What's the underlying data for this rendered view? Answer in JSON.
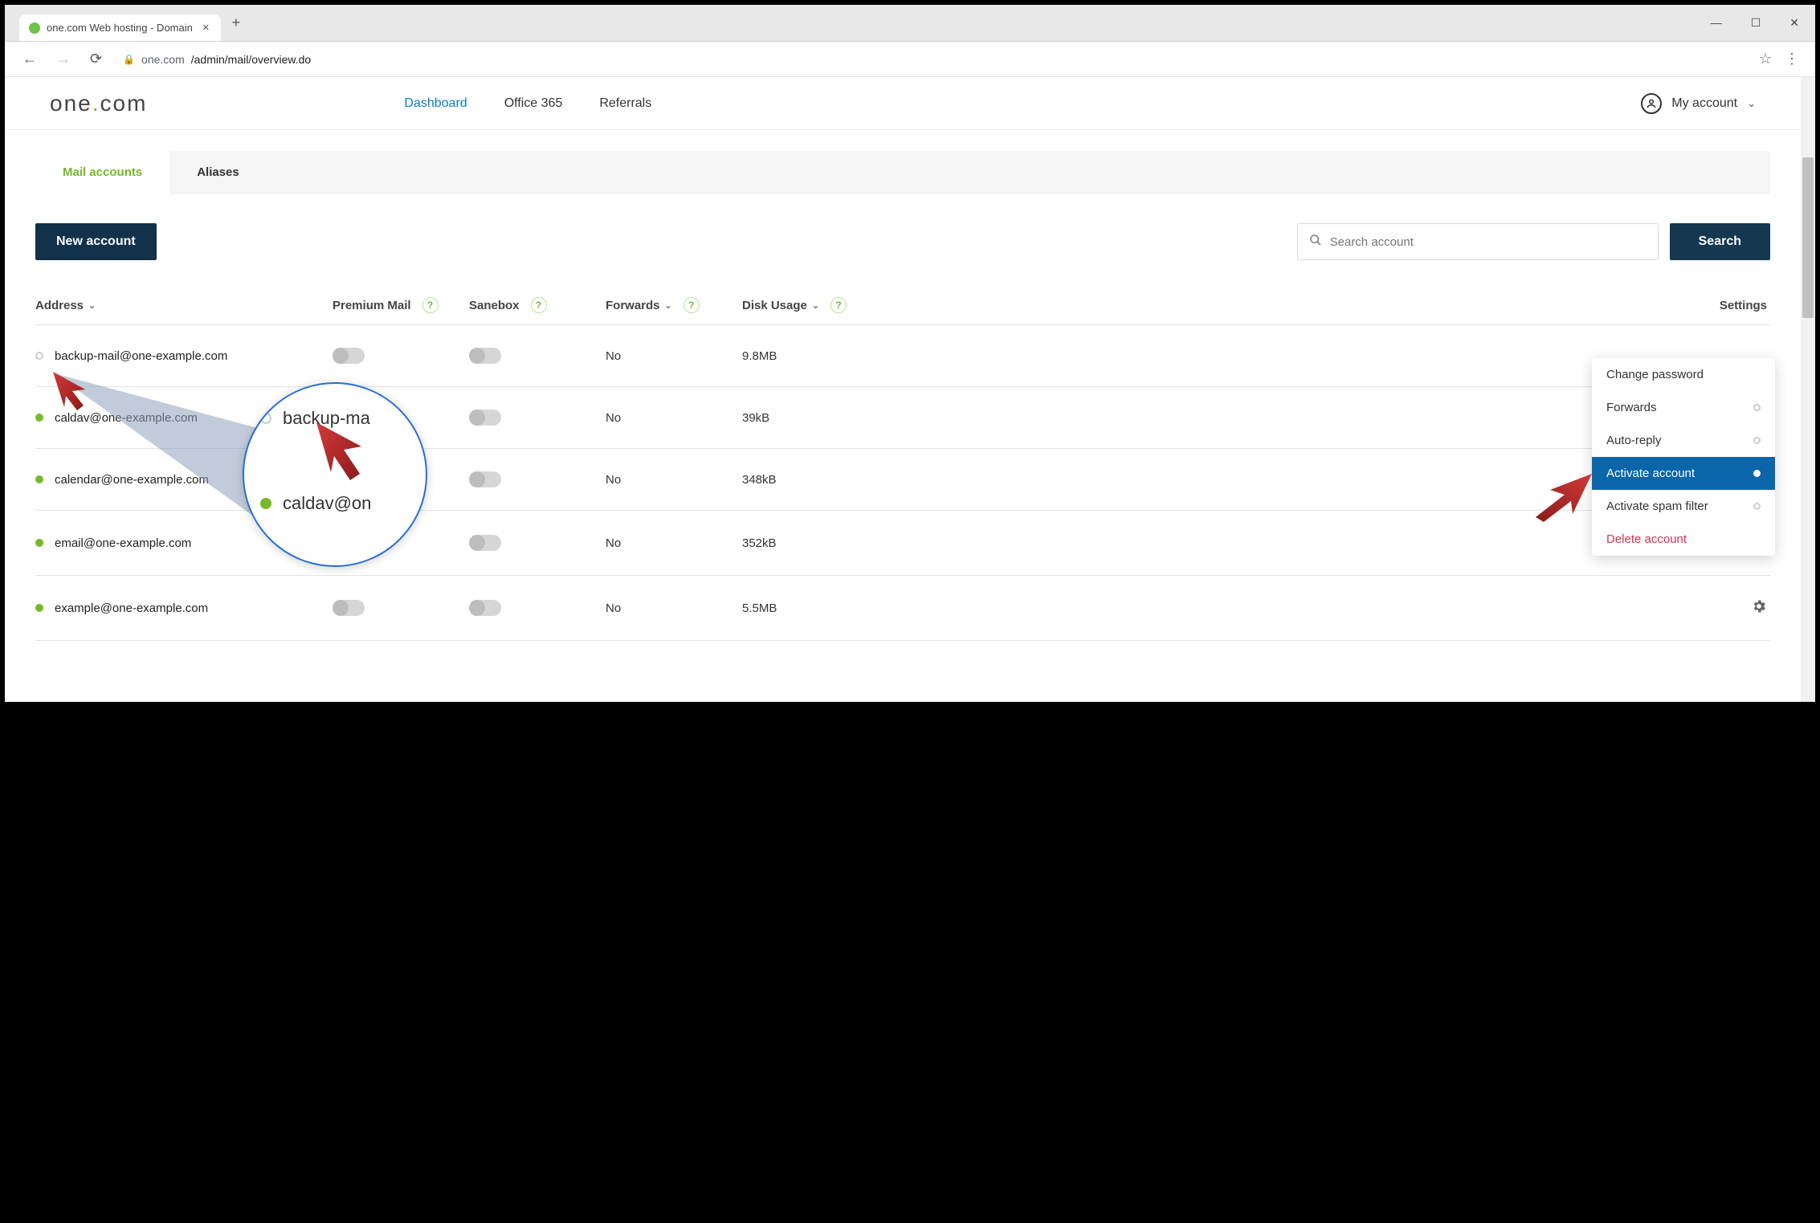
{
  "browser": {
    "tab_title": "one.com Web hosting  -  Domain",
    "url_host": "one.com",
    "url_path": "/admin/mail/overview.do"
  },
  "header": {
    "nav": {
      "dashboard": "Dashboard",
      "office365": "Office 365",
      "referrals": "Referrals"
    },
    "account_label": "My account"
  },
  "subtabs": {
    "mail_accounts": "Mail accounts",
    "aliases": "Aliases"
  },
  "actions": {
    "new_account": "New account",
    "search_placeholder": "Search account",
    "search_button": "Search"
  },
  "columns": {
    "address": "Address",
    "premium": "Premium Mail",
    "sanebox": "Sanebox",
    "forwards": "Forwards",
    "disk": "Disk Usage",
    "settings": "Settings"
  },
  "rows": [
    {
      "active": false,
      "address": "backup-mail@one-example.com",
      "premium": false,
      "sanebox": false,
      "forwards": "No",
      "disk": "9.8MB",
      "has_gear": false
    },
    {
      "active": true,
      "address": "caldav@one-example.com",
      "premium": false,
      "sanebox": false,
      "forwards": "No",
      "disk": "39kB",
      "has_gear": false
    },
    {
      "active": true,
      "address": "calendar@one-example.com",
      "premium": false,
      "sanebox": false,
      "forwards": "No",
      "disk": "348kB",
      "has_gear": false
    },
    {
      "active": true,
      "address": "email@one-example.com",
      "premium": true,
      "sanebox": false,
      "forwards": "No",
      "disk": "352kB",
      "has_gear": true
    },
    {
      "active": true,
      "address": "example@one-example.com",
      "premium": false,
      "sanebox": false,
      "forwards": "No",
      "disk": "5.5MB",
      "has_gear": true
    }
  ],
  "dropdown": {
    "change_password": "Change password",
    "forwards": "Forwards",
    "auto_reply": "Auto-reply",
    "activate_account": "Activate account",
    "activate_spam": "Activate spam filter",
    "delete_account": "Delete account"
  },
  "lens": {
    "row1": "backup-ma",
    "row2": "caldav@on"
  }
}
